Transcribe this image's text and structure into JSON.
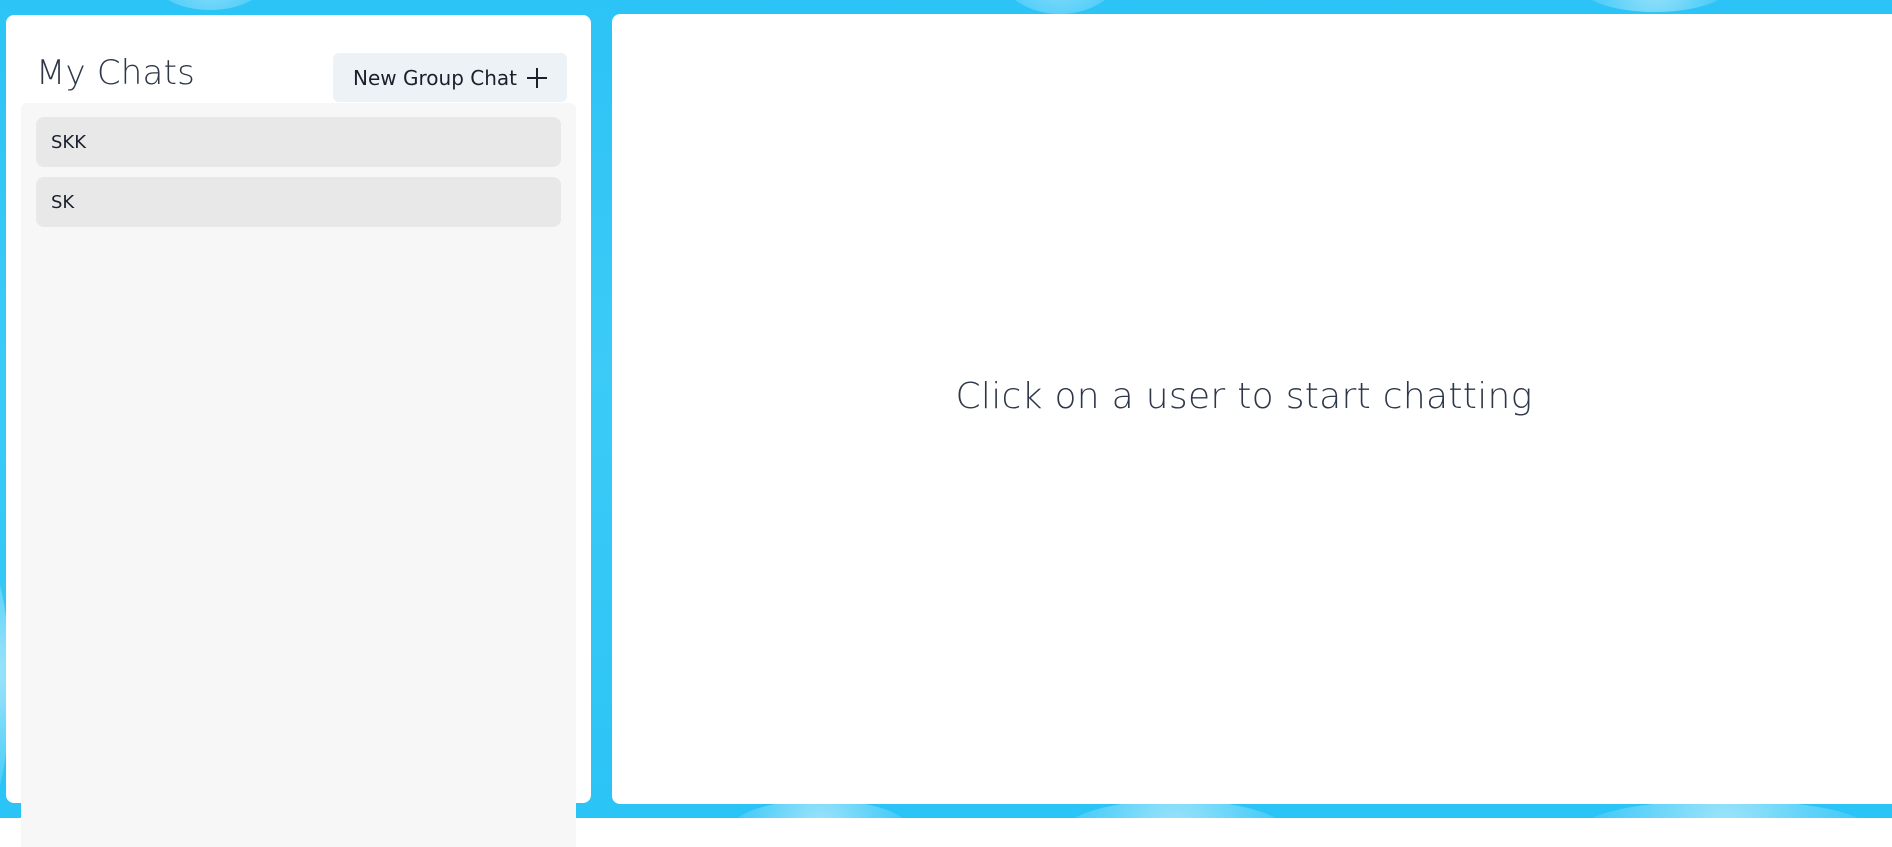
{
  "sidebar": {
    "title": "My Chats",
    "new_group_button": {
      "label": "New Group Chat",
      "icon": "plus-icon"
    },
    "chats": [
      {
        "name": "SKK"
      },
      {
        "name": "SK"
      }
    ]
  },
  "chat_box": {
    "empty_message": "Click on a user to start chatting"
  },
  "colors": {
    "background_accent": "#2cc3f6",
    "panel": "#ffffff",
    "list_background": "#f7f7f7",
    "chat_item": "#e8e8e8",
    "button_background": "#edf2f7",
    "text": "#2d3748"
  }
}
